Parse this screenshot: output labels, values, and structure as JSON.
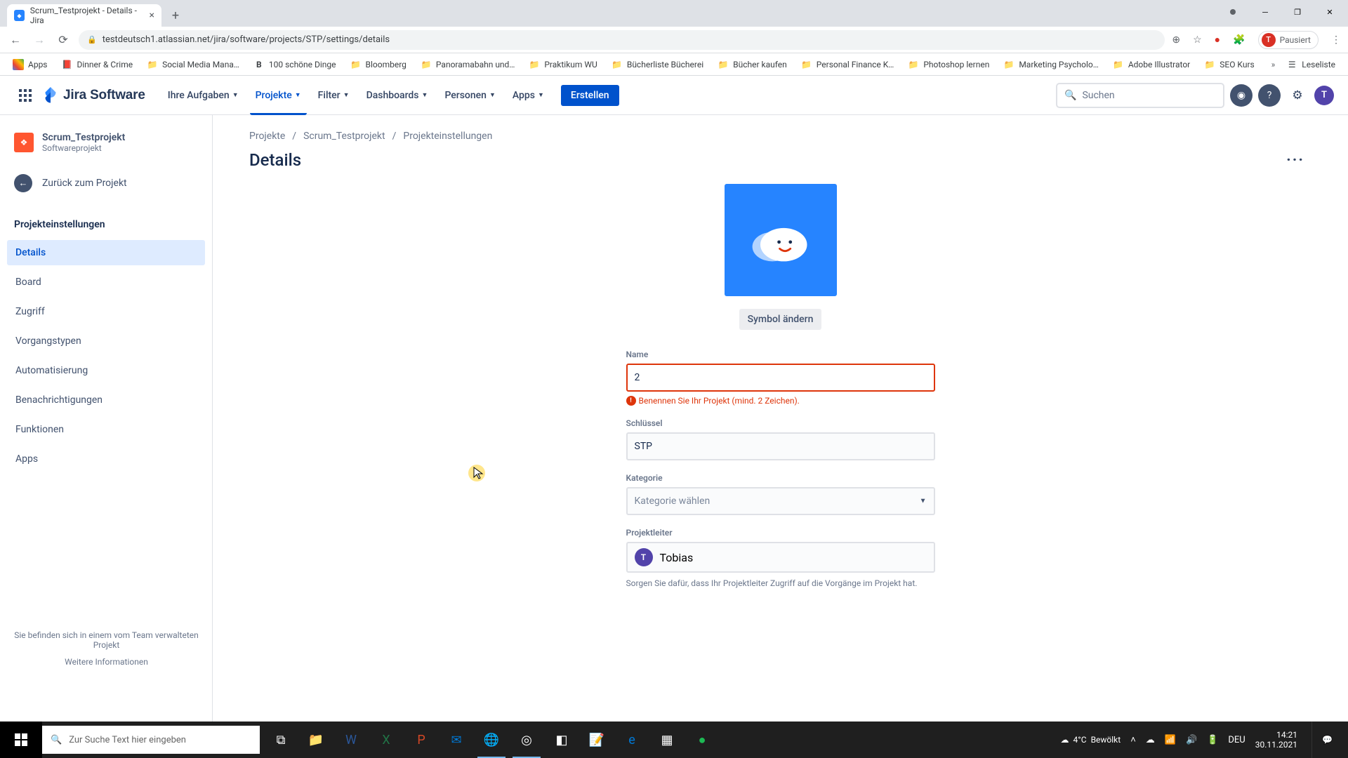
{
  "browser": {
    "tab_title": "Scrum_Testprojekt - Details - Jira",
    "url": "testdeutsch1.atlassian.net/jira/software/projects/STP/settings/details",
    "profile_status": "Pausiert",
    "profile_initial": "T"
  },
  "bookmarks": {
    "apps": "Apps",
    "items": [
      "Dinner & Crime",
      "Social Media Mana…",
      "100 schöne Dinge",
      "Bloomberg",
      "Panoramabahn und…",
      "Praktikum WU",
      "Bücherliste Bücherei",
      "Bücher kaufen",
      "Personal Finance K…",
      "Photoshop lernen",
      "Marketing Psycholo…",
      "Adobe Illustrator",
      "SEO Kurs"
    ],
    "reading_list": "Leseliste"
  },
  "jira_header": {
    "logo": "Jira Software",
    "nav": {
      "your_work": "Ihre Aufgaben",
      "projects": "Projekte",
      "filters": "Filter",
      "dashboards": "Dashboards",
      "people": "Personen",
      "apps": "Apps"
    },
    "create": "Erstellen",
    "search_placeholder": "Suchen",
    "user_initial": "T"
  },
  "sidebar": {
    "project_name": "Scrum_Testprojekt",
    "project_type": "Softwareprojekt",
    "back": "Zurück zum Projekt",
    "section": "Projekteinstellungen",
    "items": {
      "details": "Details",
      "board": "Board",
      "access": "Zugriff",
      "issue_types": "Vorgangstypen",
      "automation": "Automatisierung",
      "notifications": "Benachrichtigungen",
      "features": "Funktionen",
      "apps": "Apps"
    },
    "footer_text": "Sie befinden sich in einem vom Team verwalteten Projekt",
    "footer_link": "Weitere Informationen"
  },
  "main": {
    "breadcrumb": {
      "projects": "Projekte",
      "project": "Scrum_Testprojekt",
      "settings": "Projekteinstellungen"
    },
    "title": "Details",
    "change_icon": "Symbol ändern",
    "fields": {
      "name_label": "Name",
      "name_value": "2",
      "name_error": "Benennen Sie Ihr Projekt (mind. 2 Zeichen).",
      "key_label": "Schlüssel",
      "key_value": "STP",
      "category_label": "Kategorie",
      "category_placeholder": "Kategorie wählen",
      "lead_label": "Projektleiter",
      "lead_name": "Tobias",
      "lead_initial": "T",
      "lead_help": "Sorgen Sie dafür, dass Ihr Projektleiter Zugriff auf die Vorgänge im Projekt hat."
    }
  },
  "taskbar": {
    "search_placeholder": "Zur Suche Text hier eingeben",
    "weather_temp": "4°C",
    "weather_text": "Bewölkt",
    "lang": "DEU",
    "time": "14:21",
    "date": "30.11.2021"
  }
}
